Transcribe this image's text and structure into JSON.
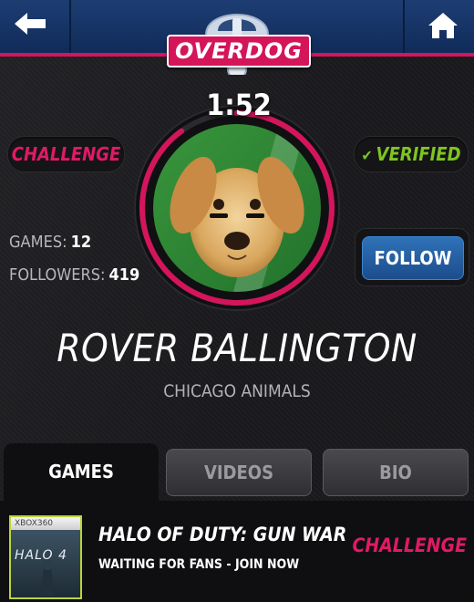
{
  "header": {
    "logo_text": "OVERDOG",
    "back_icon": "arrow-left-icon",
    "home_icon": "home-icon"
  },
  "profile": {
    "challenge_label": "CHALLENGE",
    "verified_label": "VERIFIED",
    "timer": "1:52",
    "timer_progress": 0.9,
    "stats": {
      "games_label": "GAMES:",
      "games_value": "12",
      "followers_label": "FOLLOWERS:",
      "followers_value": "419"
    },
    "follow_label": "FOLLOW",
    "name": "ROVER BALLINGTON",
    "team": "CHICAGO ANIMALS"
  },
  "tabs": [
    {
      "label": "GAMES",
      "active": true
    },
    {
      "label": "VIDEOS",
      "active": false
    },
    {
      "label": "BIO",
      "active": false
    }
  ],
  "games": [
    {
      "platform": "XBOX360",
      "cover_title": "HALO 4",
      "title": "HALO OF DUTY: GUN WAR",
      "status": "WAITING FOR FANS - JOIN NOW",
      "action": "CHALLENGE"
    }
  ],
  "colors": {
    "accent_pink": "#d4155c",
    "verified_green": "#7ec520",
    "follow_blue": "#2f72b8",
    "header_blue": "#1d3d73"
  }
}
